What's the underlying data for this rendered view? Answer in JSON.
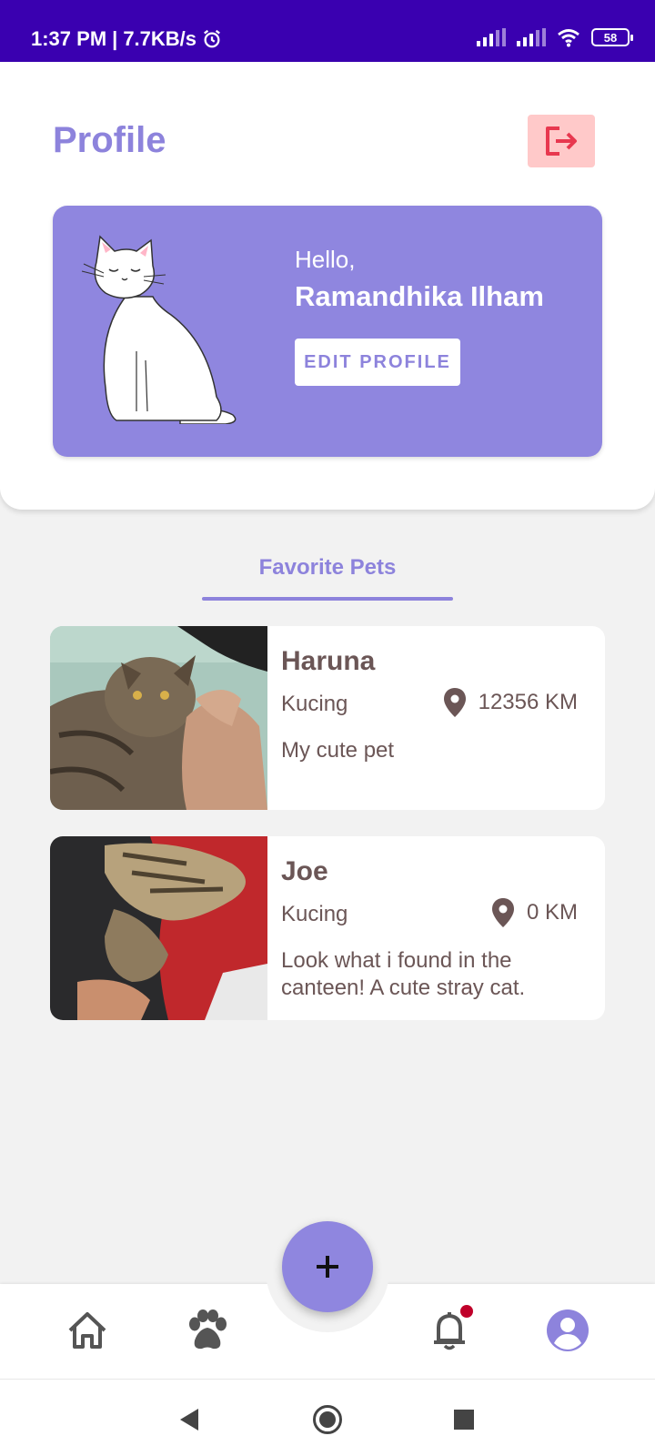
{
  "status_bar": {
    "time": "1:37 PM",
    "speed": "7.7KB/s",
    "battery": "58"
  },
  "header": {
    "title": "Profile",
    "logout_icon": "logout-icon",
    "greeting": "Hello,",
    "user_name": "Ramandhika Ilham",
    "edit_profile_label": "EDIT PROFILE"
  },
  "tabs": {
    "active_label": "Favorite Pets"
  },
  "pets": [
    {
      "name": "Haruna",
      "type": "Kucing",
      "distance": "12356 KM",
      "description": "My cute pet"
    },
    {
      "name": "Joe",
      "type": "Kucing",
      "distance": "0 KM",
      "description": "Look what i found in the canteen! A cute stray cat."
    }
  ],
  "bottom_nav": {
    "items": [
      "home-icon",
      "paw-icon",
      "bell-icon",
      "profile-icon"
    ],
    "fab_icon": "plus-icon",
    "notification_dot": true
  },
  "colors": {
    "accent": "#8d83dc",
    "status_bar": "#3a00b0",
    "logout_bg": "#ffc9c9",
    "logout_icon": "#e8384f",
    "text_dark": "#6b5656",
    "notification": "#c0002a"
  }
}
